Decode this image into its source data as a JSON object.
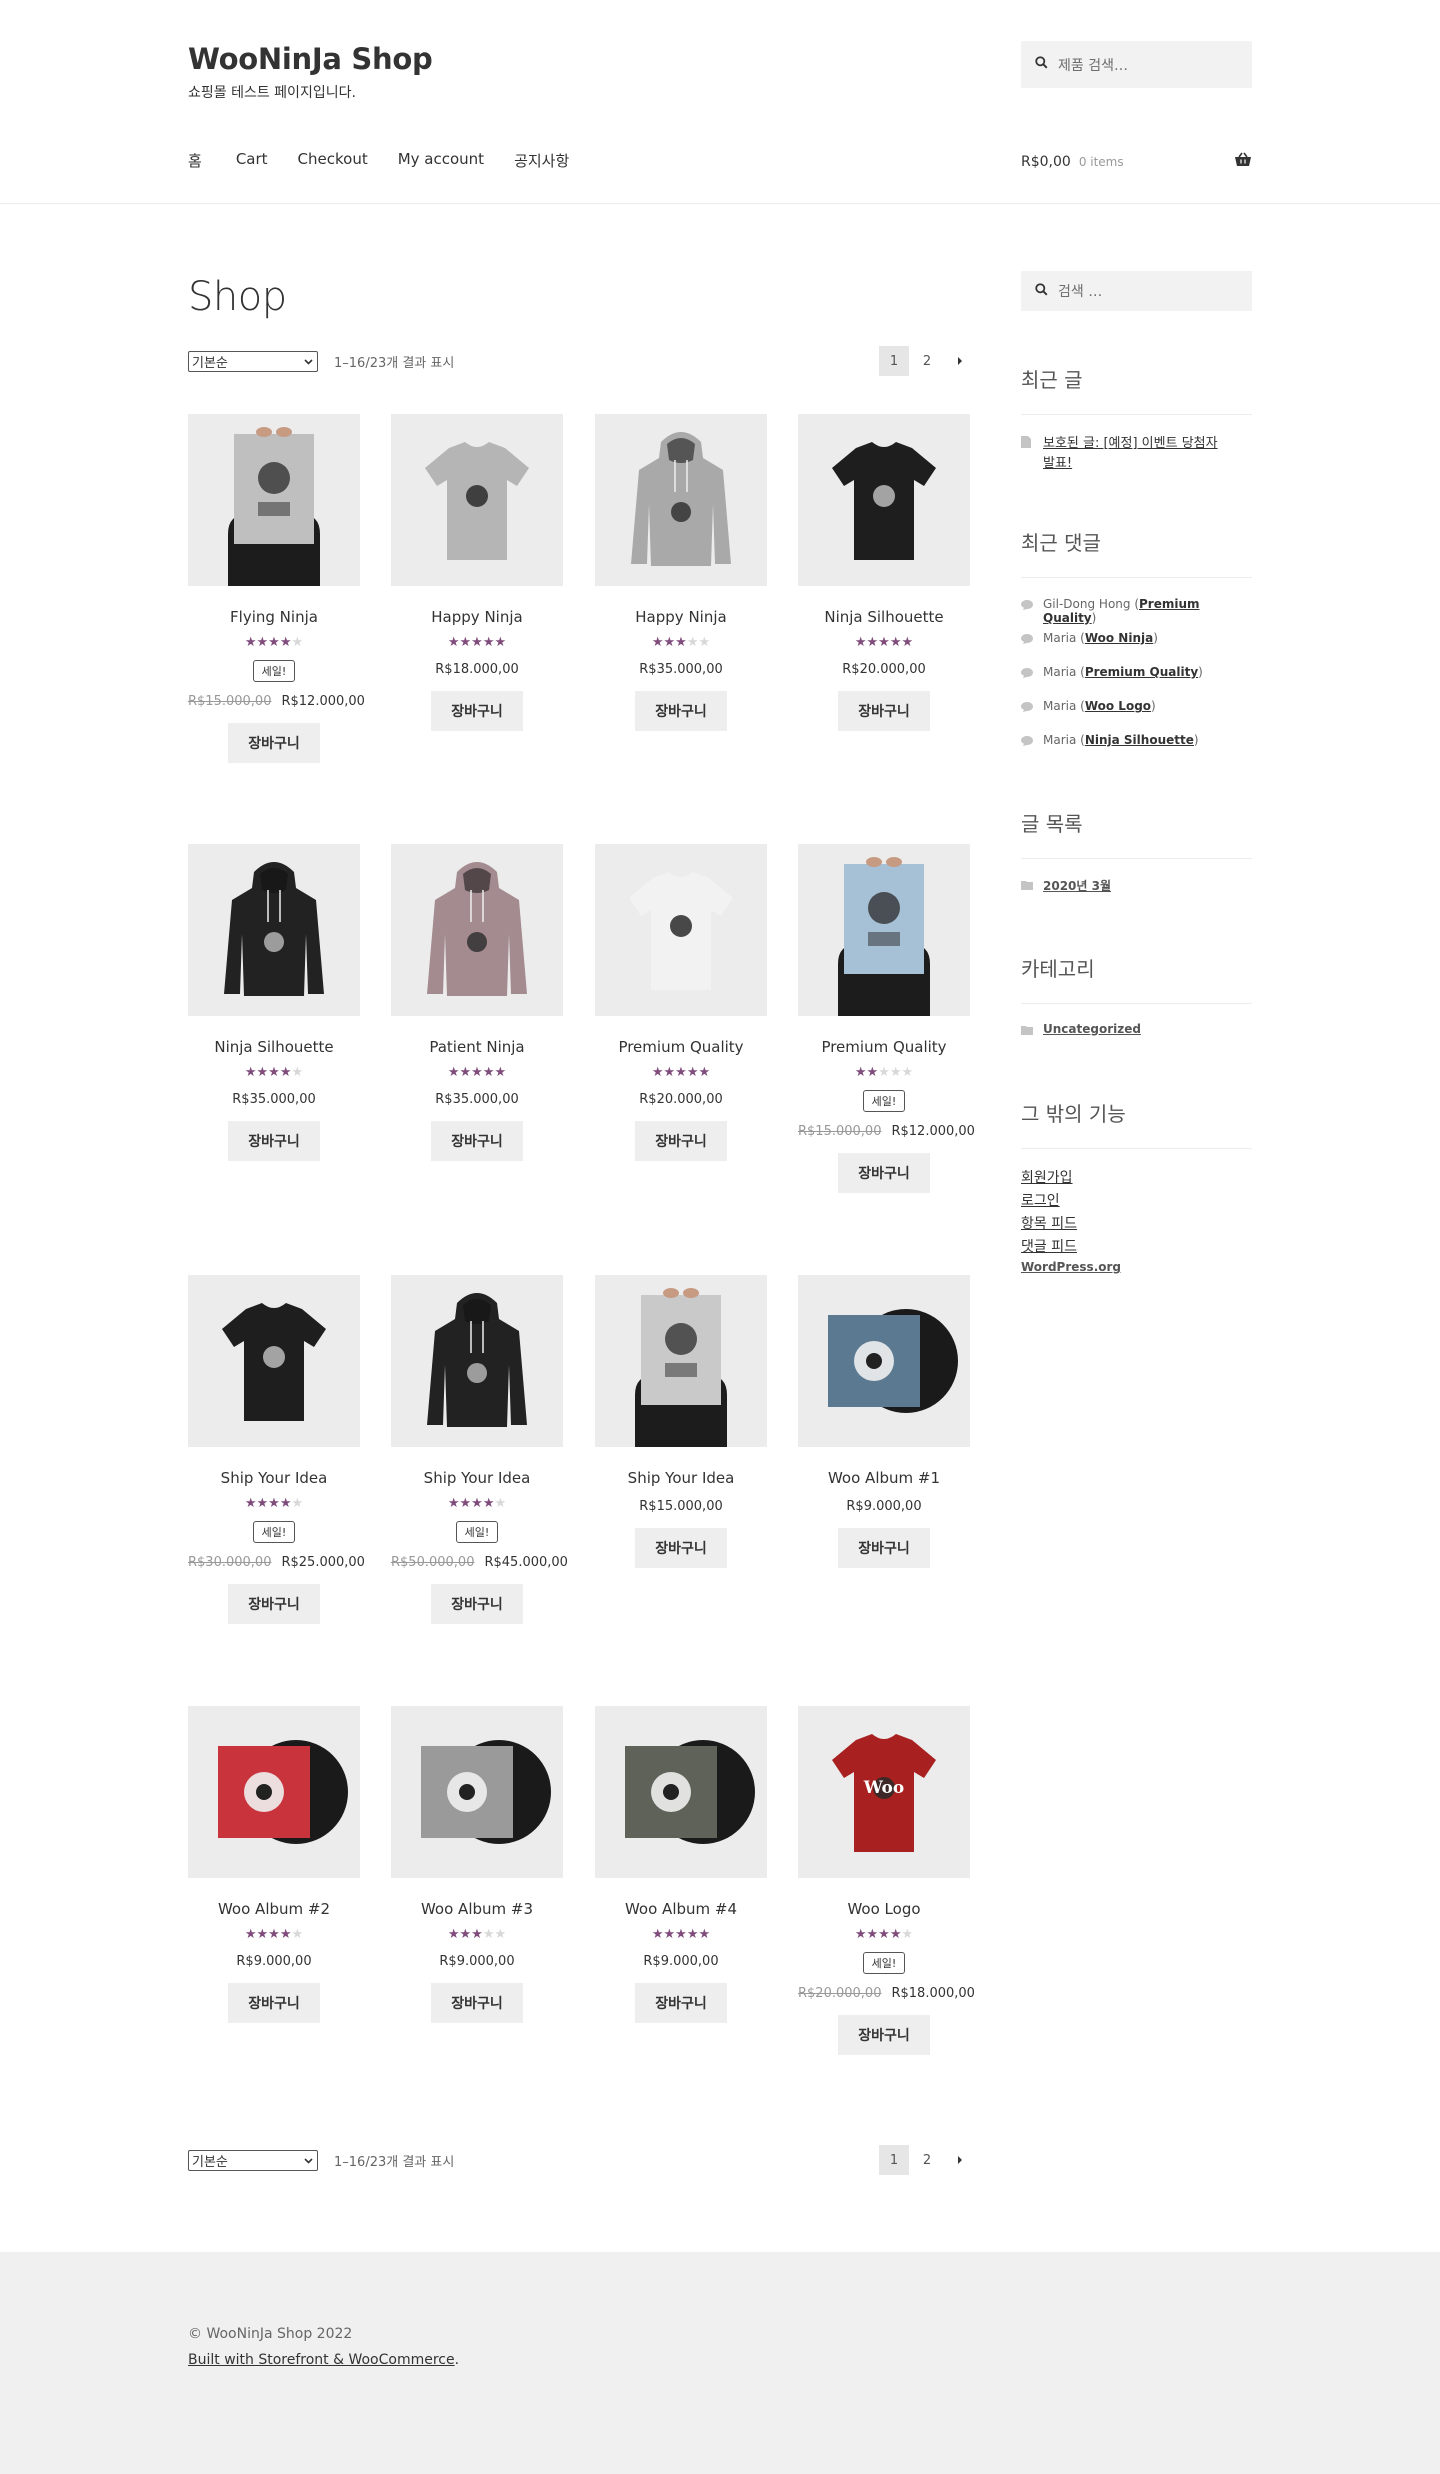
{
  "site": {
    "title": "WooNinJa Shop",
    "description": "쇼핑몰 테스트 페이지입니다."
  },
  "header_search": {
    "placeholder": "제품 검색…"
  },
  "nav": [
    "홈",
    "Cart",
    "Checkout",
    "My account",
    "공지사항"
  ],
  "cart": {
    "total": "R$0,00",
    "count": "0 items"
  },
  "page_title": "Shop",
  "toolbar": {
    "sort_value": "기본순",
    "result_count": "1–16/23개 결과 표시",
    "pages": [
      "1",
      "2"
    ]
  },
  "add_label": "장바구니",
  "sale_label": "세일!",
  "products": [
    {
      "name": "Flying Ninja",
      "rating": 4,
      "sale": true,
      "old_price": "R$15.000,00",
      "price": "R$12.000,00",
      "kind": "poster",
      "color": "#bfbfbf"
    },
    {
      "name": "Happy Ninja",
      "rating": 5,
      "sale": false,
      "old_price": "",
      "price": "R$18.000,00",
      "kind": "tshirt",
      "color": "#b5b5b5"
    },
    {
      "name": "Happy Ninja",
      "rating": 3,
      "sale": false,
      "old_price": "",
      "price": "R$35.000,00",
      "kind": "hoodie",
      "color": "#a9a9a9"
    },
    {
      "name": "Ninja Silhouette",
      "rating": 5,
      "sale": false,
      "old_price": "",
      "price": "R$20.000,00",
      "kind": "tshirt",
      "color": "#1e1e1e"
    },
    {
      "name": "Ninja Silhouette",
      "rating": 4,
      "sale": false,
      "old_price": "",
      "price": "R$35.000,00",
      "kind": "hoodie",
      "color": "#222222"
    },
    {
      "name": "Patient Ninja",
      "rating": 5,
      "sale": false,
      "old_price": "",
      "price": "R$35.000,00",
      "kind": "hoodie",
      "color": "#a48b8f"
    },
    {
      "name": "Premium Quality",
      "rating": 5,
      "sale": false,
      "old_price": "",
      "price": "R$20.000,00",
      "kind": "tshirt",
      "color": "#f2f2f2"
    },
    {
      "name": "Premium Quality",
      "rating": 2,
      "sale": true,
      "old_price": "R$15.000,00",
      "price": "R$12.000,00",
      "kind": "poster",
      "color": "#a6c0d6"
    },
    {
      "name": "Ship Your Idea",
      "rating": 4,
      "sale": true,
      "old_price": "R$30.000,00",
      "price": "R$25.000,00",
      "kind": "tshirt",
      "color": "#1e1e1e"
    },
    {
      "name": "Ship Your Idea",
      "rating": 4,
      "sale": true,
      "old_price": "R$50.000,00",
      "price": "R$45.000,00",
      "kind": "hoodie",
      "color": "#222222"
    },
    {
      "name": "Ship Your Idea",
      "rating": 0,
      "sale": false,
      "old_price": "",
      "price": "R$15.000,00",
      "kind": "poster",
      "color": "#c9c9c9"
    },
    {
      "name": "Woo Album #1",
      "rating": 0,
      "sale": false,
      "old_price": "",
      "price": "R$9.000,00",
      "kind": "album",
      "color": "#5b7a91"
    },
    {
      "name": "Woo Album #2",
      "rating": 4,
      "sale": false,
      "old_price": "",
      "price": "R$9.000,00",
      "kind": "album",
      "color": "#c8333c"
    },
    {
      "name": "Woo Album #3",
      "rating": 3,
      "sale": false,
      "old_price": "",
      "price": "R$9.000,00",
      "kind": "album",
      "color": "#9a9a9a"
    },
    {
      "name": "Woo Album #4",
      "rating": 5,
      "sale": false,
      "old_price": "",
      "price": "R$9.000,00",
      "kind": "album",
      "color": "#5e6258"
    },
    {
      "name": "Woo Logo",
      "rating": 4,
      "sale": true,
      "old_price": "R$20.000,00",
      "price": "R$18.000,00",
      "kind": "tshirt",
      "color": "#a82020"
    }
  ],
  "logo_text": "Woo",
  "sidebar": {
    "search_placeholder": "검색 …",
    "recent_posts_title": "최근 글",
    "recent_post": "보호된 글: [예정] 이벤트 당첨자 발표!",
    "recent_post_line1": "보호된 글: [예정] 이벤트 당첨자",
    "recent_post_line2": "발표!",
    "recent_comments_title": "최근 댓글",
    "comments": [
      {
        "author": "Gil-Dong Hong",
        "post": "Premium Quality"
      },
      {
        "author": "Maria",
        "post": "Woo Ninja"
      },
      {
        "author": "Maria",
        "post": "Premium Quality"
      },
      {
        "author": "Maria",
        "post": "Woo Logo"
      },
      {
        "author": "Maria",
        "post": "Ninja Silhouette"
      }
    ],
    "archives_title": "글 목록",
    "archive": "2020년 3월",
    "categories_title": "카테고리",
    "category": "Uncategorized",
    "meta_title": "그 밖의 기능",
    "meta_links": [
      "회원가입",
      "로그인",
      "항목 피드",
      "댓글 피드",
      "WordPress.org"
    ]
  },
  "footer": {
    "copyright": "© WooNinJa Shop 2022",
    "built_with": "Built with Storefront & WooCommerce"
  },
  "colors": {
    "star": "#7f4c7c",
    "star_empty": "#d8d8d8",
    "button_bg": "#eeeeee",
    "footer_bg": "#f0f0f0"
  }
}
